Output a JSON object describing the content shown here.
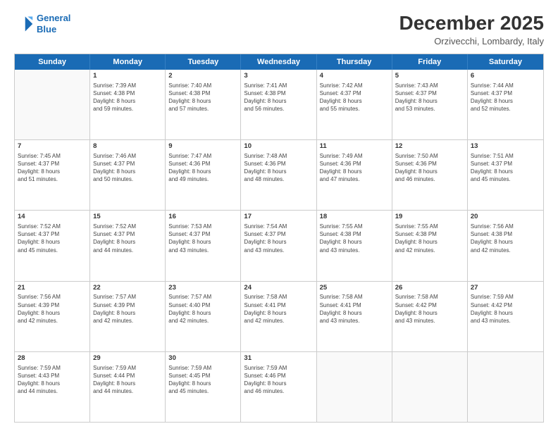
{
  "logo": {
    "line1": "General",
    "line2": "Blue"
  },
  "title": "December 2025",
  "subtitle": "Orzivecchi, Lombardy, Italy",
  "headers": [
    "Sunday",
    "Monday",
    "Tuesday",
    "Wednesday",
    "Thursday",
    "Friday",
    "Saturday"
  ],
  "weeks": [
    [
      {
        "day": "",
        "info": ""
      },
      {
        "day": "1",
        "info": "Sunrise: 7:39 AM\nSunset: 4:38 PM\nDaylight: 8 hours\nand 59 minutes."
      },
      {
        "day": "2",
        "info": "Sunrise: 7:40 AM\nSunset: 4:38 PM\nDaylight: 8 hours\nand 57 minutes."
      },
      {
        "day": "3",
        "info": "Sunrise: 7:41 AM\nSunset: 4:38 PM\nDaylight: 8 hours\nand 56 minutes."
      },
      {
        "day": "4",
        "info": "Sunrise: 7:42 AM\nSunset: 4:37 PM\nDaylight: 8 hours\nand 55 minutes."
      },
      {
        "day": "5",
        "info": "Sunrise: 7:43 AM\nSunset: 4:37 PM\nDaylight: 8 hours\nand 53 minutes."
      },
      {
        "day": "6",
        "info": "Sunrise: 7:44 AM\nSunset: 4:37 PM\nDaylight: 8 hours\nand 52 minutes."
      }
    ],
    [
      {
        "day": "7",
        "info": "Sunrise: 7:45 AM\nSunset: 4:37 PM\nDaylight: 8 hours\nand 51 minutes."
      },
      {
        "day": "8",
        "info": "Sunrise: 7:46 AM\nSunset: 4:37 PM\nDaylight: 8 hours\nand 50 minutes."
      },
      {
        "day": "9",
        "info": "Sunrise: 7:47 AM\nSunset: 4:36 PM\nDaylight: 8 hours\nand 49 minutes."
      },
      {
        "day": "10",
        "info": "Sunrise: 7:48 AM\nSunset: 4:36 PM\nDaylight: 8 hours\nand 48 minutes."
      },
      {
        "day": "11",
        "info": "Sunrise: 7:49 AM\nSunset: 4:36 PM\nDaylight: 8 hours\nand 47 minutes."
      },
      {
        "day": "12",
        "info": "Sunrise: 7:50 AM\nSunset: 4:36 PM\nDaylight: 8 hours\nand 46 minutes."
      },
      {
        "day": "13",
        "info": "Sunrise: 7:51 AM\nSunset: 4:37 PM\nDaylight: 8 hours\nand 45 minutes."
      }
    ],
    [
      {
        "day": "14",
        "info": "Sunrise: 7:52 AM\nSunset: 4:37 PM\nDaylight: 8 hours\nand 45 minutes."
      },
      {
        "day": "15",
        "info": "Sunrise: 7:52 AM\nSunset: 4:37 PM\nDaylight: 8 hours\nand 44 minutes."
      },
      {
        "day": "16",
        "info": "Sunrise: 7:53 AM\nSunset: 4:37 PM\nDaylight: 8 hours\nand 43 minutes."
      },
      {
        "day": "17",
        "info": "Sunrise: 7:54 AM\nSunset: 4:37 PM\nDaylight: 8 hours\nand 43 minutes."
      },
      {
        "day": "18",
        "info": "Sunrise: 7:55 AM\nSunset: 4:38 PM\nDaylight: 8 hours\nand 43 minutes."
      },
      {
        "day": "19",
        "info": "Sunrise: 7:55 AM\nSunset: 4:38 PM\nDaylight: 8 hours\nand 42 minutes."
      },
      {
        "day": "20",
        "info": "Sunrise: 7:56 AM\nSunset: 4:38 PM\nDaylight: 8 hours\nand 42 minutes."
      }
    ],
    [
      {
        "day": "21",
        "info": "Sunrise: 7:56 AM\nSunset: 4:39 PM\nDaylight: 8 hours\nand 42 minutes."
      },
      {
        "day": "22",
        "info": "Sunrise: 7:57 AM\nSunset: 4:39 PM\nDaylight: 8 hours\nand 42 minutes."
      },
      {
        "day": "23",
        "info": "Sunrise: 7:57 AM\nSunset: 4:40 PM\nDaylight: 8 hours\nand 42 minutes."
      },
      {
        "day": "24",
        "info": "Sunrise: 7:58 AM\nSunset: 4:41 PM\nDaylight: 8 hours\nand 42 minutes."
      },
      {
        "day": "25",
        "info": "Sunrise: 7:58 AM\nSunset: 4:41 PM\nDaylight: 8 hours\nand 43 minutes."
      },
      {
        "day": "26",
        "info": "Sunrise: 7:58 AM\nSunset: 4:42 PM\nDaylight: 8 hours\nand 43 minutes."
      },
      {
        "day": "27",
        "info": "Sunrise: 7:59 AM\nSunset: 4:42 PM\nDaylight: 8 hours\nand 43 minutes."
      }
    ],
    [
      {
        "day": "28",
        "info": "Sunrise: 7:59 AM\nSunset: 4:43 PM\nDaylight: 8 hours\nand 44 minutes."
      },
      {
        "day": "29",
        "info": "Sunrise: 7:59 AM\nSunset: 4:44 PM\nDaylight: 8 hours\nand 44 minutes."
      },
      {
        "day": "30",
        "info": "Sunrise: 7:59 AM\nSunset: 4:45 PM\nDaylight: 8 hours\nand 45 minutes."
      },
      {
        "day": "31",
        "info": "Sunrise: 7:59 AM\nSunset: 4:46 PM\nDaylight: 8 hours\nand 46 minutes."
      },
      {
        "day": "",
        "info": ""
      },
      {
        "day": "",
        "info": ""
      },
      {
        "day": "",
        "info": ""
      }
    ]
  ]
}
